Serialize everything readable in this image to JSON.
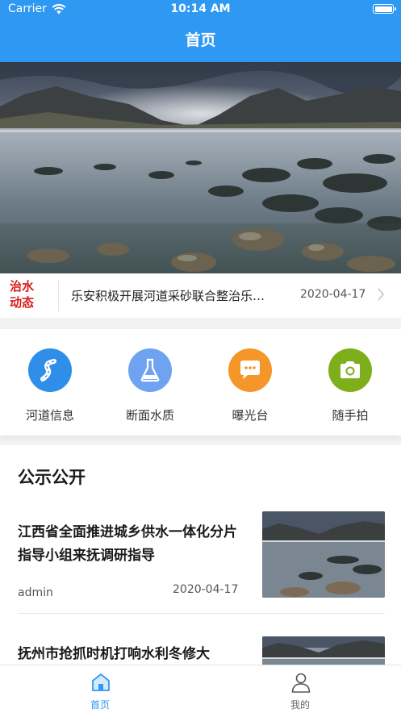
{
  "status_bar": {
    "carrier": "Carrier",
    "time": "10:14 AM"
  },
  "nav": {
    "title": "首页"
  },
  "news": {
    "tag_line1": "治水",
    "tag_line2": "动态",
    "title": "乐安积极开展河道采砂联合整治乐…",
    "date": "2020-04-17"
  },
  "quick_links": [
    {
      "label": "河道信息",
      "icon": "river-road-icon",
      "color": "#2f8fe8"
    },
    {
      "label": "断面水质",
      "icon": "flask-icon",
      "color": "#6fa3f2"
    },
    {
      "label": "曝光台",
      "icon": "chat-bubble-icon",
      "color": "#f5962a"
    },
    {
      "label": "随手拍",
      "icon": "camera-icon",
      "color": "#7fae1b"
    }
  ],
  "public_notice": {
    "title": "公示公开",
    "articles": [
      {
        "title": "江西省全面推进城乡供水一体化分片指导小组来抚调研指导",
        "author": "admin",
        "date": "2020-04-17"
      },
      {
        "title": "抚州市抢抓时机打响水利冬修大",
        "author": "",
        "date": ""
      }
    ]
  },
  "tabbar": {
    "home": "首页",
    "mine": "我的",
    "active_color": "#2f98f2",
    "inactive_color": "#666666"
  }
}
